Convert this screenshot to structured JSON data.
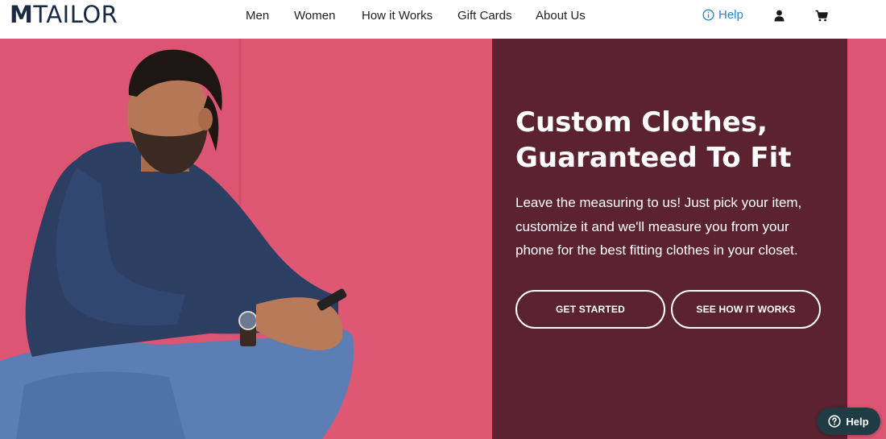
{
  "header": {
    "logo": {
      "first": "M",
      "rest": "TAILOR"
    },
    "nav": [
      "Men",
      "Women",
      "How it Works",
      "Gift Cards",
      "About Us"
    ],
    "help_label": "Help",
    "icons": [
      "info-icon",
      "user-icon",
      "cart-icon"
    ]
  },
  "hero": {
    "headline_line1": "Custom Clothes,",
    "headline_line2": "Guaranteed To Fit",
    "subtext_line1": "Leave the measuring to us! Just pick your item,",
    "subtext_line2": "customize it and we'll measure you from your",
    "subtext_line3": "phone for the best fitting clothes in your closet.",
    "primary_button": "GET STARTED",
    "secondary_button": "SEE HOW IT WORKS"
  },
  "chat_widget": {
    "label": "Help",
    "icon": "question-icon"
  },
  "colors": {
    "brand_navy": "#1a2a44",
    "hero_background": "#dc5572",
    "panel_background": "#5b2230",
    "help_link": "#2b86c5",
    "chat_widget": "#1f3b44"
  }
}
